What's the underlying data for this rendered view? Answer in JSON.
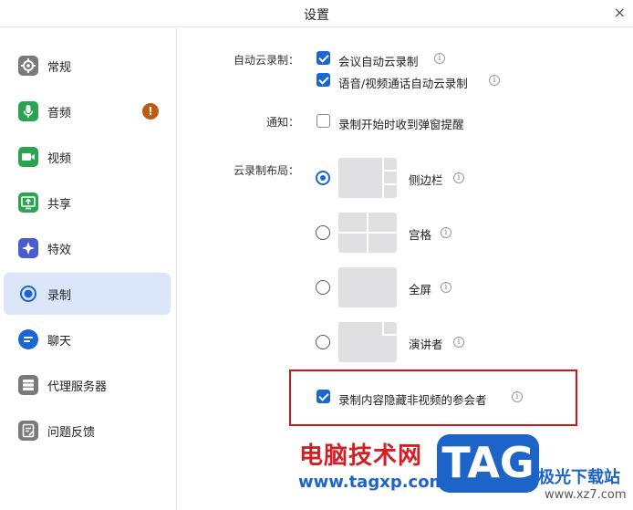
{
  "window": {
    "title": "设置",
    "close_glyph": "×"
  },
  "sidebar": {
    "items": [
      {
        "label": "常规",
        "icon": "gear-icon",
        "color": "#7a7a7a"
      },
      {
        "label": "音频",
        "icon": "microphone-icon",
        "color": "#2aa44f",
        "badge": "!"
      },
      {
        "label": "视频",
        "icon": "video-camera-icon",
        "color": "#2aa44f"
      },
      {
        "label": "共享",
        "icon": "share-screen-icon",
        "color": "#2aa44f"
      },
      {
        "label": "特效",
        "icon": "effects-icon",
        "color": "#4a5bd0"
      },
      {
        "label": "录制",
        "icon": "record-icon",
        "color": "#1a66d6",
        "active": true
      },
      {
        "label": "聊天",
        "icon": "chat-icon",
        "color": "#1a66d6"
      },
      {
        "label": "代理服务器",
        "icon": "proxy-server-icon",
        "color": "#7a7a7a"
      },
      {
        "label": "问题反馈",
        "icon": "feedback-icon",
        "color": "#7a7a7a"
      }
    ]
  },
  "main": {
    "auto_cloud": {
      "label": "自动云录制：",
      "options": [
        {
          "label": "会议自动云录制",
          "checked": true,
          "info": "i"
        },
        {
          "label": "语音/视频通话自动云录制",
          "checked": true,
          "info": "i"
        }
      ]
    },
    "notify": {
      "label": "通知：",
      "option": {
        "label": "录制开始时收到弹窗提醒",
        "checked": false
      }
    },
    "layout": {
      "label": "云录制布局：",
      "options": [
        {
          "label": "侧边栏",
          "selected": true,
          "info": "i"
        },
        {
          "label": "宫格",
          "selected": false,
          "info": "i"
        },
        {
          "label": "全屏",
          "selected": false,
          "info": "i"
        },
        {
          "label": "演讲者",
          "selected": false,
          "info": "i"
        }
      ]
    },
    "hide_nonvideo": {
      "label": "录制内容隐藏非视频的参会者",
      "checked": true,
      "info": "i"
    },
    "highlight_color": "#c8191e",
    "accent_color": "#1a66d6"
  },
  "watermark": {
    "site_name": "电脑技术网",
    "site_url": "www.tagxp.com",
    "tag": "TAG",
    "right_text": "极光下载站",
    "right_url": "www.xz7.com"
  }
}
